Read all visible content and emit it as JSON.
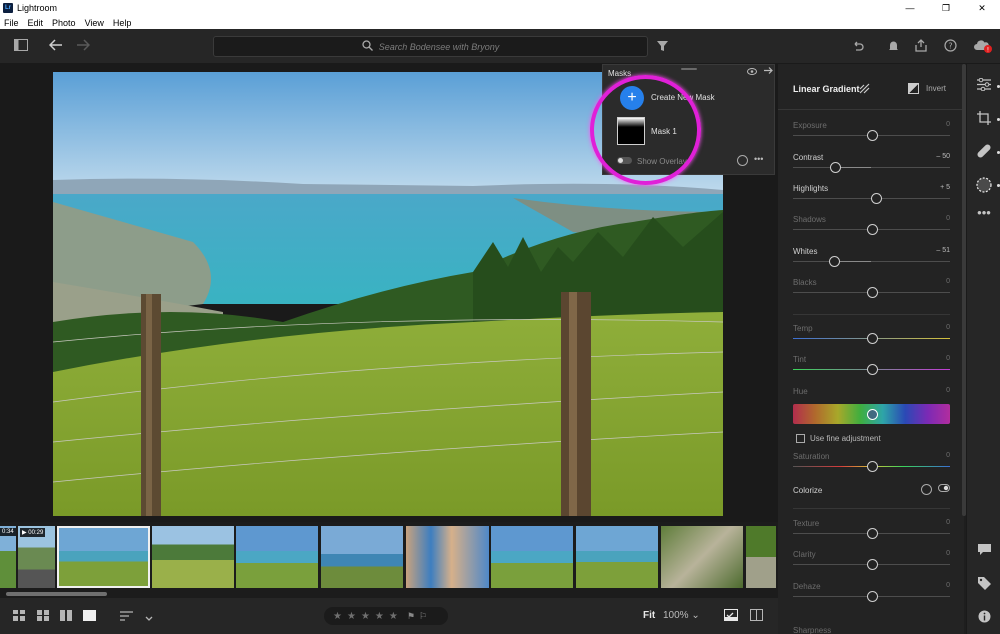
{
  "app": {
    "title": "Lightroom",
    "logo": "Lr"
  },
  "window_buttons": [
    "—",
    "❐",
    "✕"
  ],
  "menu": [
    "File",
    "Edit",
    "Photo",
    "View",
    "Help"
  ],
  "toolbar": {
    "search_placeholder": "Search Bodensee with Bryony"
  },
  "masks_panel": {
    "title": "Masks",
    "create_label": "Create New Mask",
    "mask_name": "Mask 1",
    "overlay_label": "Show Overlay"
  },
  "filmstrip": {
    "durations": [
      "0:34",
      "00:29"
    ]
  },
  "bottom": {
    "fit_label": "Fit",
    "zoom_label": "100%"
  },
  "right_panel": {
    "title": "Linear Gradient",
    "invert_label": "Invert",
    "sliders": [
      {
        "label": "Exposure",
        "value": "0",
        "position": 0.5,
        "active": false
      },
      {
        "label": "Contrast",
        "value": "– 50",
        "position": 0.27,
        "active": true
      },
      {
        "label": "Highlights",
        "value": "+ 5",
        "position": 0.53,
        "active": true
      },
      {
        "label": "Shadows",
        "value": "0",
        "position": 0.5,
        "active": false
      },
      {
        "label": "Whites",
        "value": "– 51",
        "position": 0.26,
        "active": true
      },
      {
        "label": "Blacks",
        "value": "0",
        "position": 0.5,
        "active": false
      },
      {
        "label": "Temp",
        "value": "0",
        "position": 0.5,
        "active": false
      },
      {
        "label": "Tint",
        "value": "0",
        "position": 0.5,
        "active": false
      },
      {
        "label": "Hue",
        "value": "0",
        "position": 0.5,
        "active": false
      },
      {
        "label": "Saturation",
        "value": "0",
        "position": 0.5,
        "active": false
      },
      {
        "label": "Texture",
        "value": "0",
        "position": 0.5,
        "active": false
      },
      {
        "label": "Clarity",
        "value": "0",
        "position": 0.5,
        "active": false
      },
      {
        "label": "Dehaze",
        "value": "0",
        "position": 0.5,
        "active": false
      }
    ],
    "fine_adjustment_label": "Use fine adjustment",
    "colorize_label": "Colorize",
    "sharpness_label": "Sharpness"
  },
  "colors": {
    "accent_blue": "#2680eb",
    "highlight_magenta": "#e020d8",
    "panel_bg": "#232323"
  }
}
